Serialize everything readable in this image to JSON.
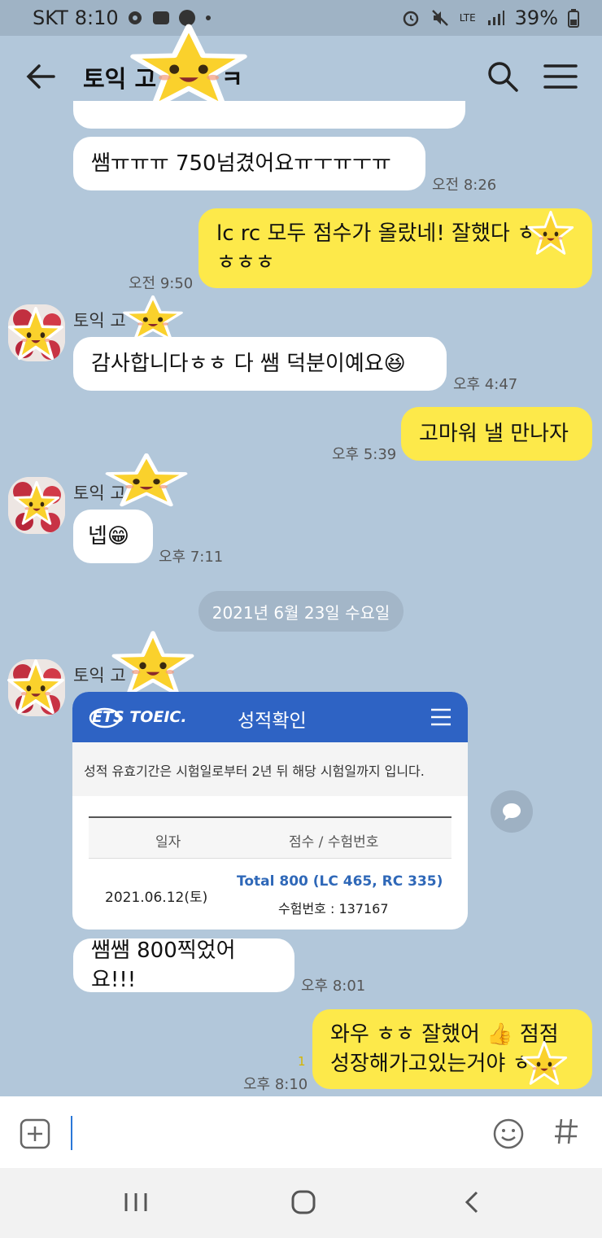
{
  "status_bar": {
    "carrier": "SKT",
    "time": "8:10",
    "network": "LTE",
    "battery": "39%"
  },
  "header": {
    "title": "토익 고",
    "title_suffix": "ㅋ"
  },
  "messages": [
    {
      "text": "쌤ㅠㅠㅠ 750넘겼어요ㅠㅜㅠㅜㅠ",
      "time": "오전 8:26"
    },
    {
      "text": "lc rc 모두 점수가 올랐네! 잘했다 ㅎ\nㅎㅎㅎ",
      "time": "오전 9:50"
    },
    {
      "sender": "토익 고",
      "text": "감사합니다ㅎㅎ 다 쌤 덕분이예요😆",
      "time": "오후 4:47"
    },
    {
      "text": "고마워 낼 만나자",
      "time": "오후 5:39"
    },
    {
      "sender": "토익 고",
      "text": "넵😁",
      "time": "오후 7:11"
    },
    {
      "sender": "토익 고",
      "text": "쌤쌤 800찍었어요!!!",
      "time": "오후 8:01"
    },
    {
      "text": "와우 ㅎㅎ 잘했어 👍 점점\n성장해가고있는거야 ㅎ",
      "time": "오후 8:10",
      "unread": "1"
    }
  ],
  "date_divider": "2021년 6월 23일 수요일",
  "score_card": {
    "logo": "ETS TOEIC.",
    "title": "성적확인",
    "notice": "성적 유효기간은 시험일로부터 2년 뒤 해당 시험일까지 입니다.",
    "columns": [
      "일자",
      "점수 / 수험번호"
    ],
    "row": {
      "date": "2021.06.12(토)",
      "total": "Total 800 (LC 465, RC 335)",
      "exam_number": "수험번호 : 137167"
    }
  },
  "input": {
    "value": ""
  },
  "icons": {
    "back": "arrow-left-icon",
    "search": "search-icon",
    "menu": "hamburger-icon",
    "attach": "plus-square-icon",
    "emoji": "smiley-icon",
    "hashtag": "hashtag-icon",
    "sticker": "star-sticker"
  },
  "colors": {
    "chat_bg": "#b2c7da",
    "my_bubble": "#fde94a",
    "their_bubble": "#ffffff",
    "card_header": "#2e63c4",
    "score_blue": "#2f68b8"
  }
}
